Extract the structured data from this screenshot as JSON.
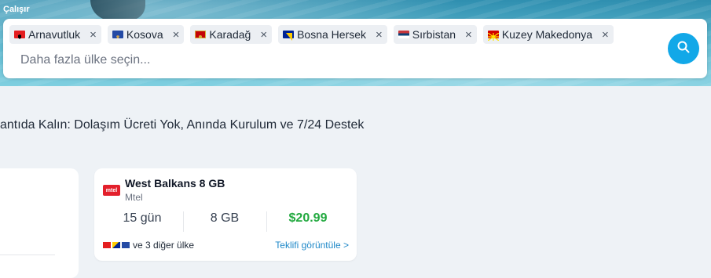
{
  "hero": {
    "label": "Çalışır"
  },
  "search": {
    "chips": [
      {
        "label": "Arnavutluk",
        "flag_color": "#e41e20"
      },
      {
        "label": "Kosova",
        "flag_color": "#244aa5"
      },
      {
        "label": "Karadağ",
        "flag_color": "#c40308"
      },
      {
        "label": "Bosna Hersek",
        "flag_color": "#002395"
      },
      {
        "label": "Sırbistan",
        "flag_color": "#c6363c"
      },
      {
        "label": "Kuzey Makedonya",
        "flag_color": "#d20000"
      }
    ],
    "remove_icon": "×",
    "placeholder": "Daha fazla ülke seçin...",
    "button_icon": "search-icon"
  },
  "headline": "antıda Kalın: Dolaşım Ücreti Yok, Anında Kurulum ve 7/24 Destek",
  "plan": {
    "logo_text": "mtel",
    "title": "West Balkans 8 GB",
    "provider": "Mtel",
    "duration": "15 gün",
    "data": "8 GB",
    "price": "$20.99",
    "countries_text": "ve 3 diğer ülke",
    "offer_link": "Teklifi görüntüle >"
  },
  "colors": {
    "accent": "#12a8e8",
    "price": "#22a93f",
    "link": "#1e88c8"
  }
}
